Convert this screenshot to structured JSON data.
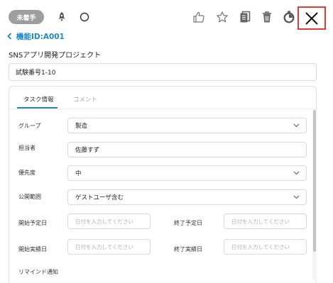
{
  "header": {
    "status_badge": "未着手",
    "back_label": "機能ID:A001",
    "project_title": "SNSアプリ開発プロジェクト",
    "test_number": "試験番号1-10",
    "toolbar_icons": [
      "rocket-icon",
      "circle-icon",
      "thumbs-up-icon",
      "star-icon",
      "copy-icon",
      "trash-icon",
      "timer-icon",
      "close-icon"
    ]
  },
  "tabs": [
    {
      "label": "タスク情報",
      "active": true
    },
    {
      "label": "コメント",
      "active": false
    }
  ],
  "form": {
    "group": {
      "label": "グループ",
      "value": "製造"
    },
    "assignee": {
      "label": "担当者",
      "value": "佐藤すず"
    },
    "priority": {
      "label": "優先度",
      "value": "中"
    },
    "visibility": {
      "label": "公開範囲",
      "value": "ゲストユーザ含む"
    },
    "planned_start": {
      "label": "開始予定日",
      "placeholder": "日付を入力してください"
    },
    "planned_end": {
      "label": "終了予定日",
      "placeholder": "日付を入力してください"
    },
    "actual_start": {
      "label": "開始実績日",
      "placeholder": "日付を入力してください"
    },
    "actual_end": {
      "label": "終了実績日",
      "placeholder": "日付を入力してください"
    },
    "reminder": {
      "label": "リマインド通知"
    }
  },
  "colors": {
    "accent": "#1e88c8",
    "badge": "#9e9e9e",
    "close_highlight": "#e53935"
  }
}
